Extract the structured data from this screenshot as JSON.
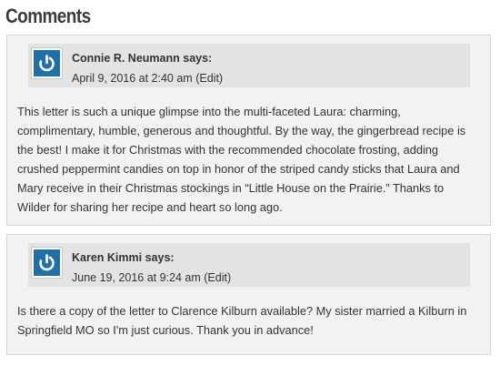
{
  "section": {
    "title": "Comments"
  },
  "comments": [
    {
      "author": "Connie R. Neumann",
      "says": "says:",
      "date": "April 9, 2016 at 2:40 am",
      "edit": "(Edit)",
      "avatar_icon": "power-icon",
      "body": "This letter is such a unique glimpse into the multi-faceted Laura: charming, complimentary, humble, generous and thoughtful. By the way, the gingerbread recipe is the best! I make it for Christmas with the recommended chocolate frosting, adding crushed peppermint candies on top in honor of the striped candy sticks that Laura and Mary receive in their Christmas stockings in “Little House on the Prairie.” Thanks to Wilder for sharing her recipe and heart so long ago."
    },
    {
      "author": "Karen Kimmi",
      "says": "says:",
      "date": "June 19, 2016 at 9:24 am",
      "edit": "(Edit)",
      "avatar_icon": "power-icon",
      "body": "Is there a copy of the letter to Clarence Kilburn available? My sister married a Kilburn in Springfield MO so I'm just curious. Thank you in advance!"
    }
  ],
  "colors": {
    "avatar_bg": "#1f6fa8",
    "card_bg": "#f2f2f2",
    "header_bg": "#e3e3e3",
    "text": "#333333"
  }
}
